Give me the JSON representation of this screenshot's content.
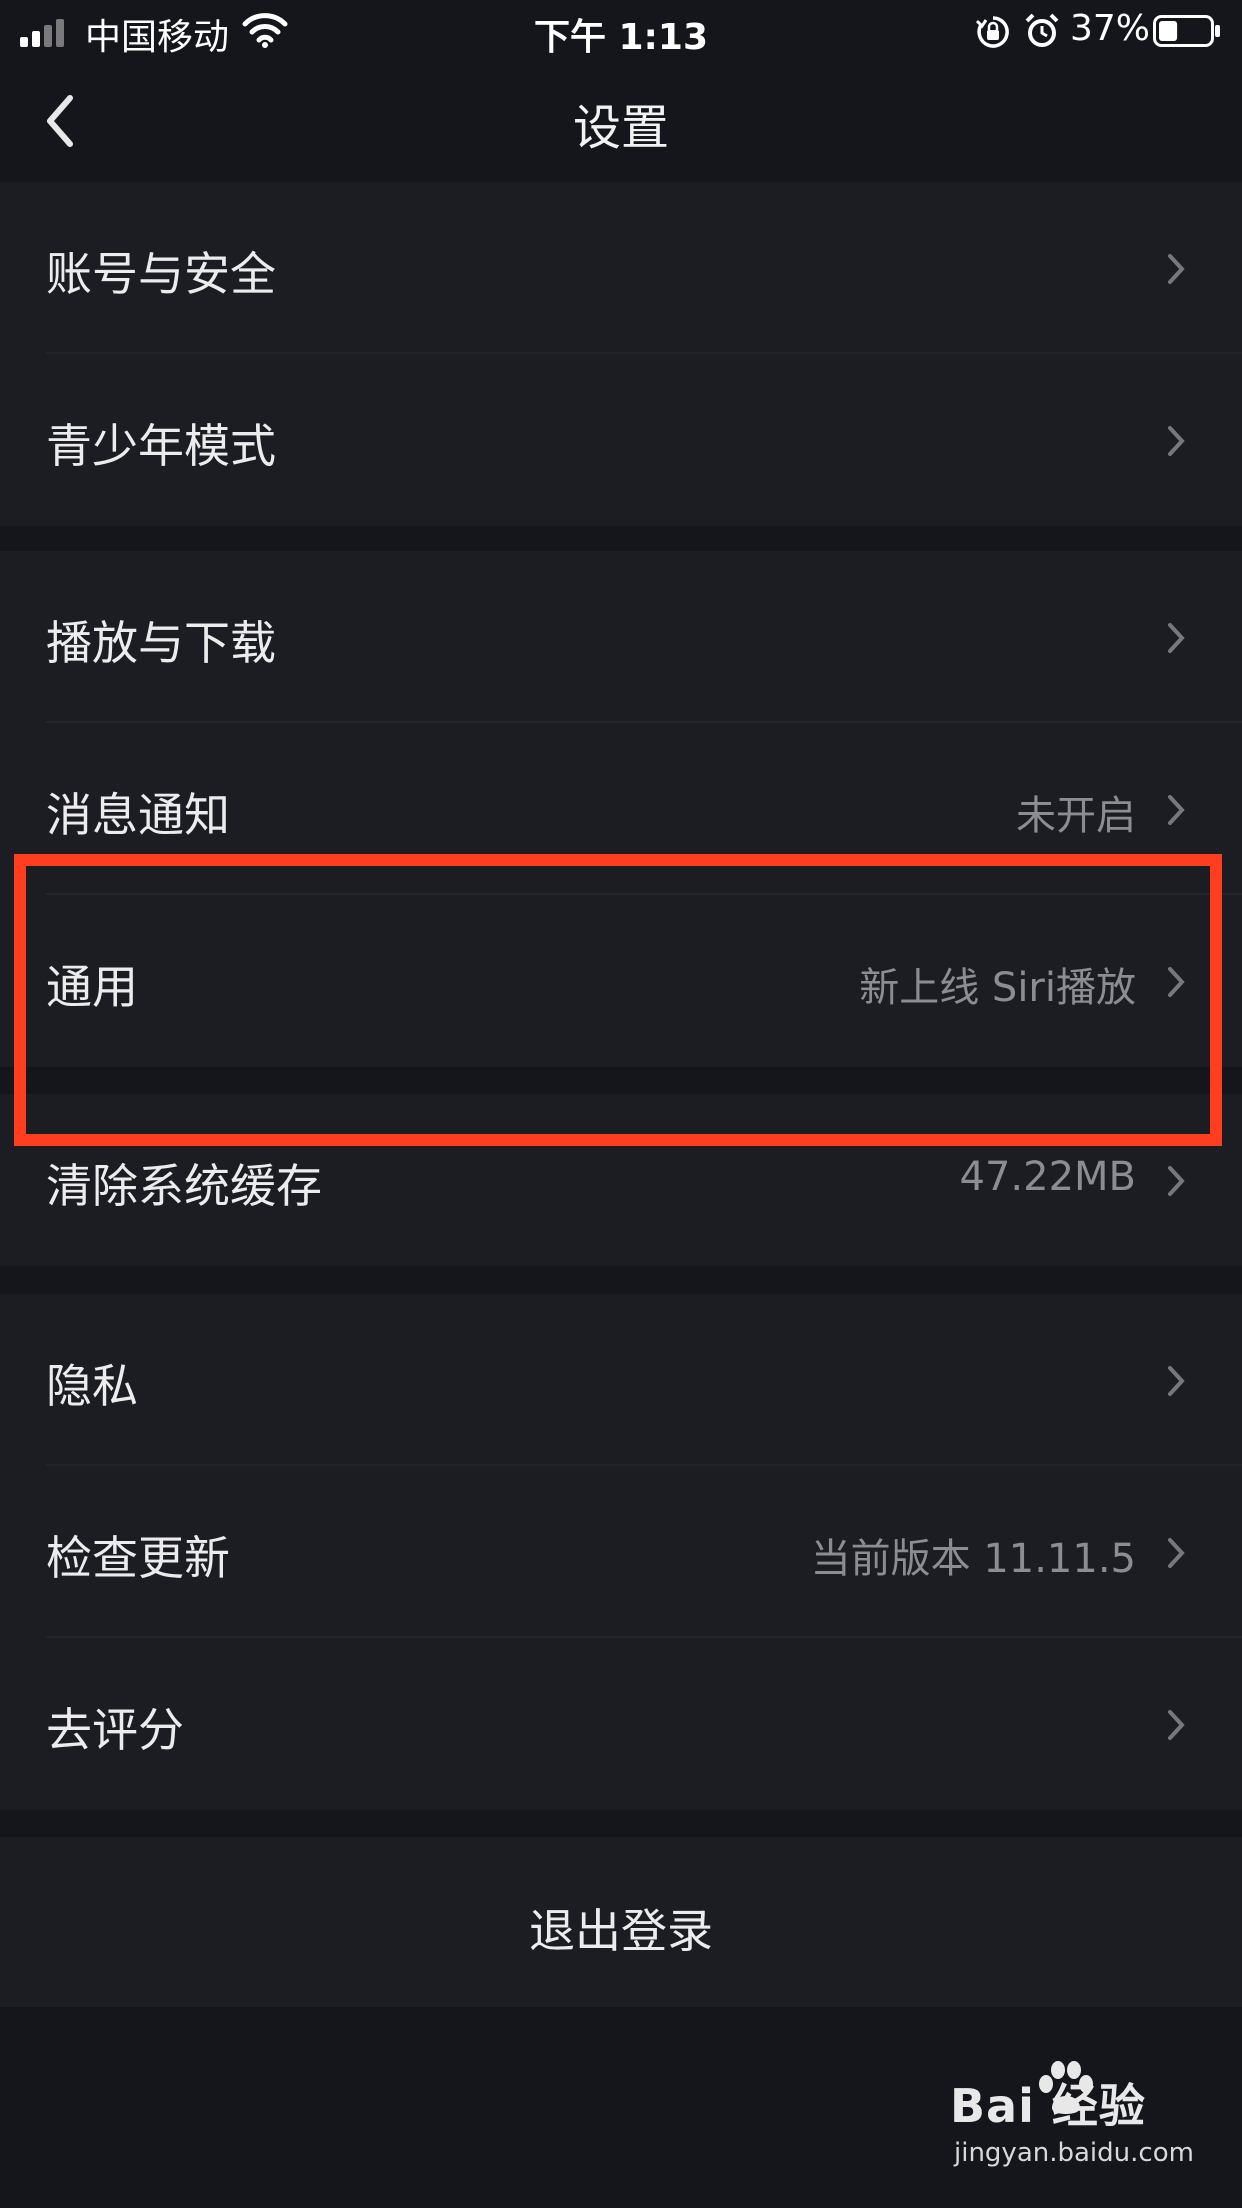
{
  "status_bar": {
    "carrier": "中国移动",
    "time": "下午 1:13",
    "battery_percent": "37%",
    "battery_level": 0.37,
    "icons": [
      "signal-icon",
      "wifi-icon",
      "rotation-lock-icon",
      "alarm-icon",
      "battery-icon"
    ]
  },
  "nav": {
    "title": "设置",
    "back_icon": "chevron-left-icon"
  },
  "groups": [
    {
      "items": [
        {
          "label": "账号与安全",
          "value": ""
        },
        {
          "label": "青少年模式",
          "value": ""
        }
      ]
    },
    {
      "items": [
        {
          "label": "播放与下载",
          "value": ""
        },
        {
          "label": "消息通知",
          "value": "未开启"
        },
        {
          "label": "通用",
          "value": "新上线 Siri播放"
        }
      ]
    },
    {
      "items": [
        {
          "label": "清除系统缓存",
          "value": "47.22MB"
        }
      ]
    },
    {
      "items": [
        {
          "label": "隐私",
          "value": ""
        },
        {
          "label": "检查更新",
          "value": "当前版本 11.11.5"
        },
        {
          "label": "去评分",
          "value": ""
        }
      ]
    }
  ],
  "logout": {
    "label": "退出登录"
  },
  "colors": {
    "background": "#14161b",
    "cell": "#1b1d23",
    "highlight": "#ff3d1f",
    "secondary_text": "#8c8d92"
  },
  "watermark": {
    "brand": "Bai 经验",
    "url": "jingyan.baidu.com"
  }
}
